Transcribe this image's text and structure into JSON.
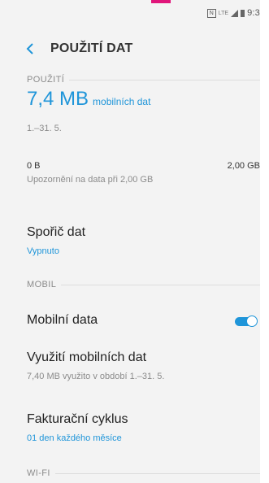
{
  "status_bar": {
    "nfc_label": "N",
    "network_label": "LTE",
    "icons": [
      "nfc-icon",
      "lte-icon",
      "signal-icon",
      "battery-icon"
    ],
    "clock": "9:3"
  },
  "header": {
    "back_icon": "chevron-left-icon",
    "title": "POUŽITÍ DAT"
  },
  "usage_section": {
    "label": "POUŽITÍ",
    "amount": "7,4 MB",
    "amount_caption": "mobilních dat",
    "period": "1.–31. 5."
  },
  "data_limit": {
    "min_label": "0 B",
    "max_label": "2,00 GB",
    "warning": "Upozornění na data při 2,00 GB"
  },
  "data_saver": {
    "title": "Spořič dat",
    "status": "Vypnuto"
  },
  "mobile_section": {
    "label": "MOBIL",
    "mobile_data": {
      "title": "Mobilní data",
      "enabled": true
    },
    "mobile_usage": {
      "title": "Využití mobilních dat",
      "subtitle": "7,40 MB využito v období 1.–31. 5."
    },
    "billing_cycle": {
      "title": "Fakturační cyklus",
      "subtitle": "01 den každého měsíce"
    }
  },
  "wifi_section": {
    "label": "WI-FI"
  },
  "colors": {
    "accent": "#1f95d9",
    "background": "#f3f3f3",
    "pink_mark": "#e0157a"
  }
}
